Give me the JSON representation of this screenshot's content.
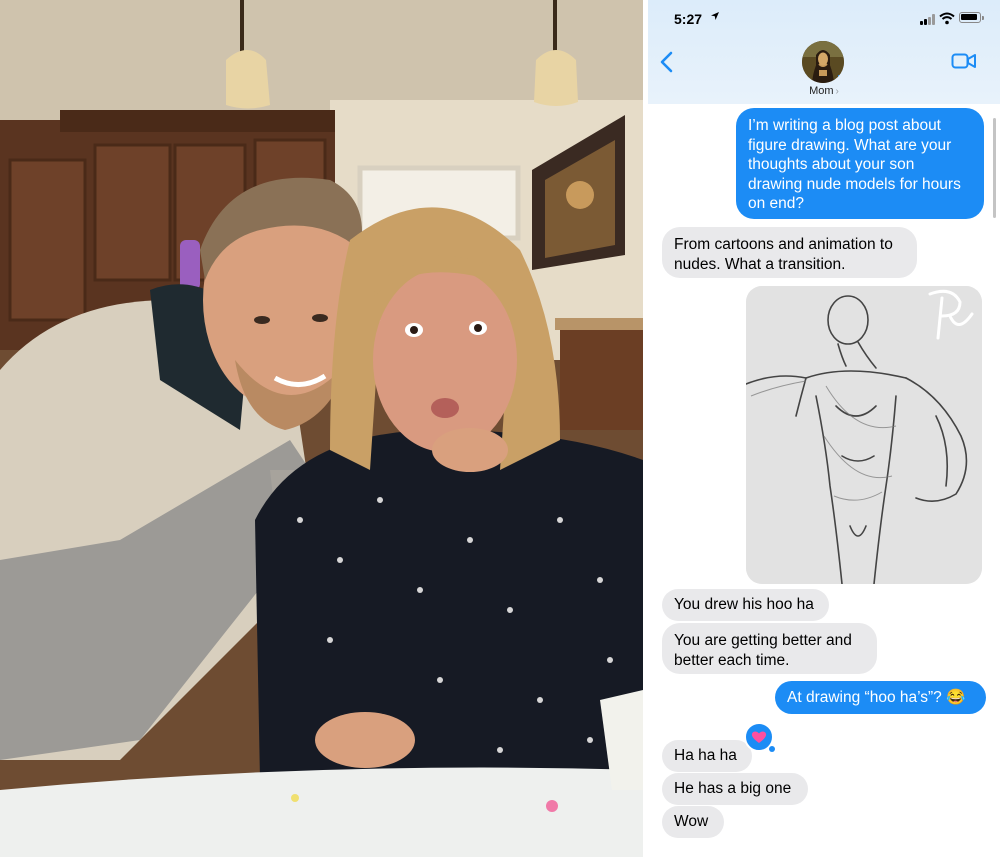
{
  "status_bar": {
    "time": "5:27"
  },
  "header": {
    "contact_name": "Mom"
  },
  "messages": [
    {
      "from": "me",
      "text": "I’m writing a blog post about figure drawing. What are your thoughts about your son drawing nude models for hours on end?"
    },
    {
      "from": "mom",
      "text": "From cartoons and animation to nudes. What a transition."
    },
    {
      "from": "me",
      "type": "image",
      "text": ""
    },
    {
      "from": "mom",
      "text": "You drew his hoo ha"
    },
    {
      "from": "mom",
      "text": "You are getting better and better each time."
    },
    {
      "from": "me",
      "text": "At drawing “hoo ha’s”? 😂"
    },
    {
      "from": "mom",
      "text": "Ha ha ha"
    },
    {
      "from": "mom",
      "text": "He has a big one"
    },
    {
      "from": "mom",
      "text": "Wow"
    }
  ],
  "colors": {
    "outgoing_bubble": "#1c8cf5",
    "incoming_bubble": "#e9e9eb",
    "header_bg": "#dcecfa",
    "tapback": "#1c8cf5",
    "heart": "#ff4fa0"
  },
  "icons": [
    "back-chevron-icon",
    "video-call-icon",
    "location-arrow-icon",
    "signal-icon",
    "wifi-icon",
    "battery-icon",
    "heart-tapback-icon"
  ]
}
